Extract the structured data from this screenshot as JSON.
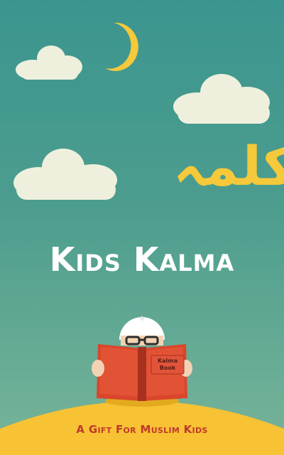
{
  "app": {
    "title": "Kids Kalma",
    "urdu_title": "کلمہ",
    "tagline": "A Gift For Muslim Kids"
  },
  "book": {
    "label_line1": "Kalma",
    "label_line2": "Book"
  },
  "icons": [
    "moon-icon",
    "cloud-icon",
    "kid-reading-illustration",
    "hill"
  ],
  "colors": {
    "sky_top": "#3b958f",
    "sky_bottom": "#78b499",
    "moon": "#f5c93a",
    "cloud": "#eef0dd",
    "hill": "#f7c234",
    "book": "#d9462c",
    "title_text": "#ffffff",
    "tagline_text": "#c0392b"
  }
}
